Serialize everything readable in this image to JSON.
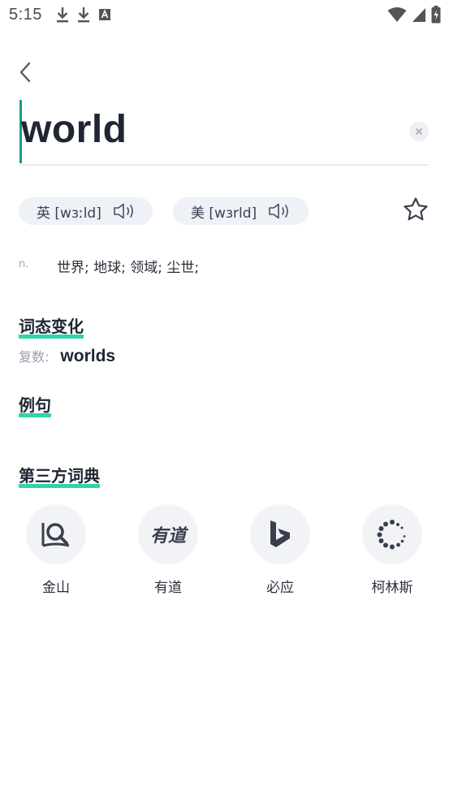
{
  "status_bar": {
    "time": "5:15"
  },
  "entry": {
    "word": "world"
  },
  "pronunciations": [
    {
      "region": "英",
      "ipa": "[wɜːld]",
      "text": "英 [wɜːld]"
    },
    {
      "region": "美",
      "ipa": "[wɜrld]",
      "text": "美 [wɜrld]"
    }
  ],
  "definition": {
    "pos": "n.",
    "meaning": "世界; 地球; 领域; 尘世;"
  },
  "sections": {
    "inflections_title": "词态变化",
    "examples_title": "例句",
    "third_party_title": "第三方词典"
  },
  "inflections": {
    "plural_label": "复数:",
    "plural_value": "worlds"
  },
  "dictionaries": [
    {
      "name": "金山",
      "icon": "kingsoft-icon"
    },
    {
      "name": "有道",
      "icon": "youdao-icon"
    },
    {
      "name": "必应",
      "icon": "bing-icon"
    },
    {
      "name": "柯林斯",
      "icon": "collins-icon"
    }
  ],
  "colors": {
    "accent": "#2fd4a8",
    "cursor": "#1a9a88",
    "text": "#1f2533",
    "pill_bg": "#eef1f6",
    "icon_dark": "#3a3f4e"
  }
}
